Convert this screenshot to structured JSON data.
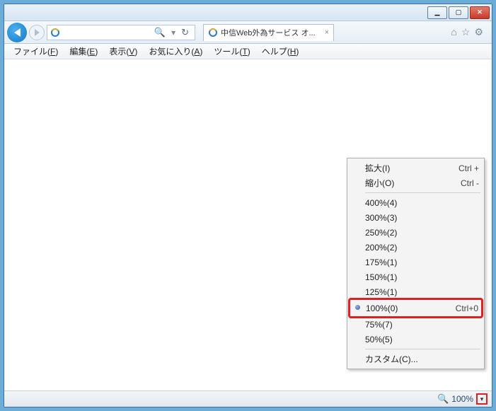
{
  "window_controls": {
    "min": "▁",
    "max": "▢",
    "close": "✕"
  },
  "tab": {
    "title": "中信Web外為サービス オ...",
    "close": "×"
  },
  "nav_icons": {
    "home": "⌂",
    "star": "☆",
    "gear": "⚙"
  },
  "search_icon": "🔍",
  "refresh_icon": "↻",
  "menubar": [
    {
      "pre": "ファイル(",
      "u": "F",
      "post": ")"
    },
    {
      "pre": "編集(",
      "u": "E",
      "post": ")"
    },
    {
      "pre": "表示(",
      "u": "V",
      "post": ")"
    },
    {
      "pre": "お気に入り(",
      "u": "A",
      "post": ")"
    },
    {
      "pre": "ツール(",
      "u": "T",
      "post": ")"
    },
    {
      "pre": "ヘルプ(",
      "u": "H",
      "post": ")"
    }
  ],
  "context": {
    "zoom_in": {
      "label": "拡大(I)",
      "shortcut": "Ctrl +"
    },
    "zoom_out": {
      "label": "縮小(O)",
      "shortcut": "Ctrl -"
    },
    "levels": [
      "400%(4)",
      "300%(3)",
      "250%(2)",
      "200%(2)",
      "175%(1)",
      "150%(1)",
      "125%(1)"
    ],
    "selected": {
      "label": "100%(0)",
      "shortcut": "Ctrl+0"
    },
    "lower": [
      "75%(7)",
      "50%(5)"
    ],
    "custom": "カスタム(C)..."
  },
  "status": {
    "zoom": "100%",
    "chev": "▾"
  }
}
